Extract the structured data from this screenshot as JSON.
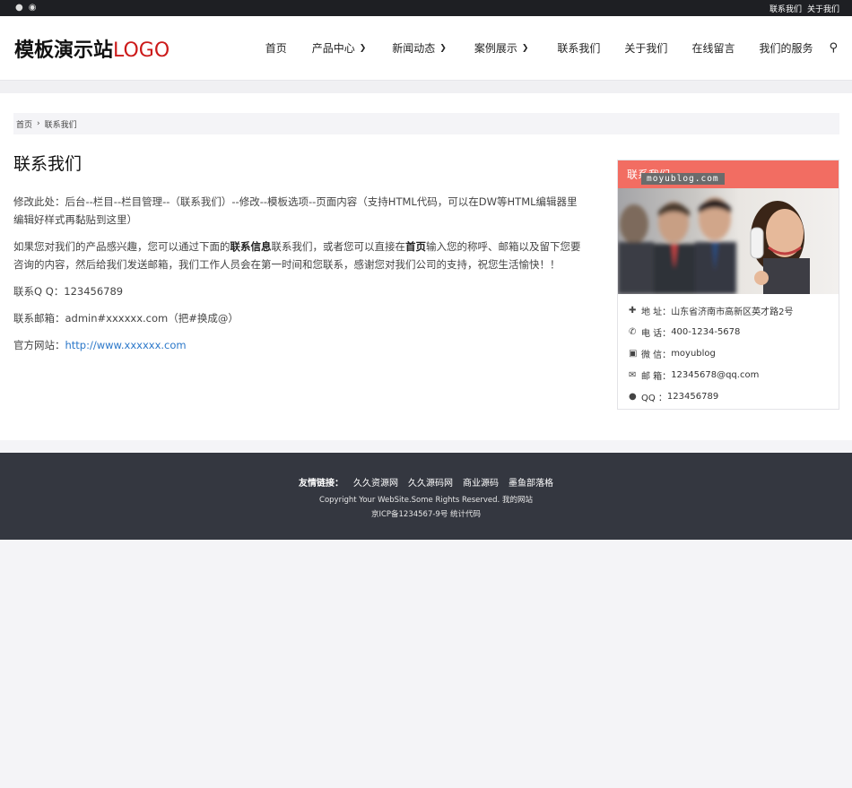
{
  "topbar": {
    "icons": [
      "qq-icon",
      "weibo-icon"
    ],
    "links": [
      "联系我们",
      "关于我们"
    ]
  },
  "header": {
    "logo_main": "模板演示站",
    "logo_accent": "LOGO",
    "nav": [
      {
        "label": "首页",
        "dropdown": false
      },
      {
        "label": "产品中心",
        "dropdown": true
      },
      {
        "label": "新闻动态",
        "dropdown": true
      },
      {
        "label": "案例展示",
        "dropdown": true
      },
      {
        "label": "联系我们",
        "dropdown": false
      },
      {
        "label": "关于我们",
        "dropdown": false
      },
      {
        "label": "在线留言",
        "dropdown": false
      },
      {
        "label": "我们的服务",
        "dropdown": false
      }
    ]
  },
  "breadcrumb": {
    "home": "首页",
    "current": "联系我们"
  },
  "article": {
    "title": "联系我们",
    "p1": "修改此处：后台--栏目--栏目管理--（联系我们）--修改--模板选项--页面内容（支持HTML代码，可以在DW等HTML编辑器里编辑好样式再黏贴到这里）",
    "p2_a": "如果您对我们的产品感兴趣，您可以通过下面的",
    "p2_b1": "联系信息",
    "p2_c": "联系我们，或者您可以直接在",
    "p2_b2": "首页",
    "p2_d": "输入您的称呼、邮箱以及留下您要咨询的内容，然后给我们发送邮箱，我们工作人员会在第一时间和您联系，感谢您对我们公司的支持，祝您生活愉快！！",
    "qq_label": "联系Q Q：",
    "qq": "123456789",
    "email_label": "联系邮箱：",
    "email": "admin#xxxxxx.com（把#换成@）",
    "site_label": "官方网站：",
    "site": "http://www.xxxxxx.com"
  },
  "sidebar": {
    "title": "联系我们",
    "watermark": "moyublog.com",
    "items": [
      {
        "icon": "map-sign-icon",
        "label": "地 址：",
        "value": "山东省济南市高新区英才路2号"
      },
      {
        "icon": "phone-icon",
        "label": "电 话：",
        "value": "400-1234-5678"
      },
      {
        "icon": "wechat-icon",
        "label": "微 信：",
        "value": "moyublog"
      },
      {
        "icon": "envelope-icon",
        "label": "邮 箱：",
        "value": "12345678@qq.com"
      },
      {
        "icon": "qq-icon",
        "label": "QQ ：",
        "value": "123456789"
      }
    ]
  },
  "footer": {
    "friends_label": "友情链接：",
    "friends": [
      "久久资源网",
      "久久源码网",
      "商业源码",
      "墨鱼部落格"
    ],
    "copyright": "Copyright Your WebSite.Some Rights Reserved. 我的网站",
    "icp": "京ICP备1234567-9号 统计代码"
  }
}
